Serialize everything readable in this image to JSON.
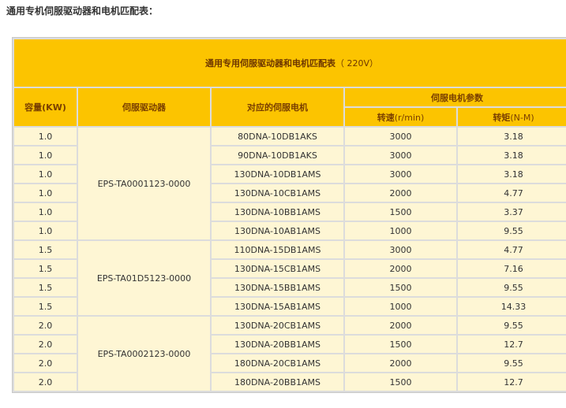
{
  "heading": "通用专机伺服驱动器和电机匹配表：",
  "table": {
    "title_main": "通用专用伺服驱动器和电机匹配表",
    "title_suffix": "（ 220V）",
    "headers": {
      "capacity": "容量(KW)",
      "driver": "伺服驱动器",
      "motor": "对应的伺服电机",
      "params": "伺服电机参数",
      "speed_label": "转速",
      "speed_unit": "(r/min)",
      "torque_label": "转矩",
      "torque_unit": "(N-M)"
    },
    "groups": [
      {
        "driver": "EPS-TA0001123-0000",
        "rows": [
          {
            "capacity": "1.0",
            "motor": "80DNA-10DB1AKS",
            "speed": "3000",
            "torque": "3.18"
          },
          {
            "capacity": "1.0",
            "motor": "90DNA-10DB1AKS",
            "speed": "3000",
            "torque": "3.18"
          },
          {
            "capacity": "1.0",
            "motor": "130DNA-10DB1AMS",
            "speed": "3000",
            "torque": "3.18"
          },
          {
            "capacity": "1.0",
            "motor": "130DNA-10CB1AMS",
            "speed": "2000",
            "torque": "4.77"
          },
          {
            "capacity": "1.0",
            "motor": "130DNA-10BB1AMS",
            "speed": "1500",
            "torque": "3.37"
          },
          {
            "capacity": "1.0",
            "motor": "130DNA-10AB1AMS",
            "speed": "1000",
            "torque": "9.55"
          }
        ]
      },
      {
        "driver": "EPS-TA01D5123-0000",
        "rows": [
          {
            "capacity": "1.5",
            "motor": "110DNA-15DB1AMS",
            "speed": "3000",
            "torque": "4.77"
          },
          {
            "capacity": "1.5",
            "motor": "130DNA-15CB1AMS",
            "speed": "2000",
            "torque": "7.16"
          },
          {
            "capacity": "1.5",
            "motor": "130DNA-15BB1AMS",
            "speed": "1500",
            "torque": "9.55"
          },
          {
            "capacity": "1.5",
            "motor": "130DNA-15AB1AMS",
            "speed": "1000",
            "torque": "14.33"
          }
        ]
      },
      {
        "driver": "EPS-TA0002123-0000",
        "rows": [
          {
            "capacity": "2.0",
            "motor": "130DNA-20CB1AMS",
            "speed": "2000",
            "torque": "9.55"
          },
          {
            "capacity": "2.0",
            "motor": "130DNA-20BB1AMS",
            "speed": "1500",
            "torque": "12.7"
          },
          {
            "capacity": "2.0",
            "motor": "180DNA-20CB1AMS",
            "speed": "2000",
            "torque": "9.55"
          },
          {
            "capacity": "2.0",
            "motor": "180DNA-20BB1AMS",
            "speed": "1500",
            "torque": "12.7"
          }
        ]
      }
    ]
  }
}
